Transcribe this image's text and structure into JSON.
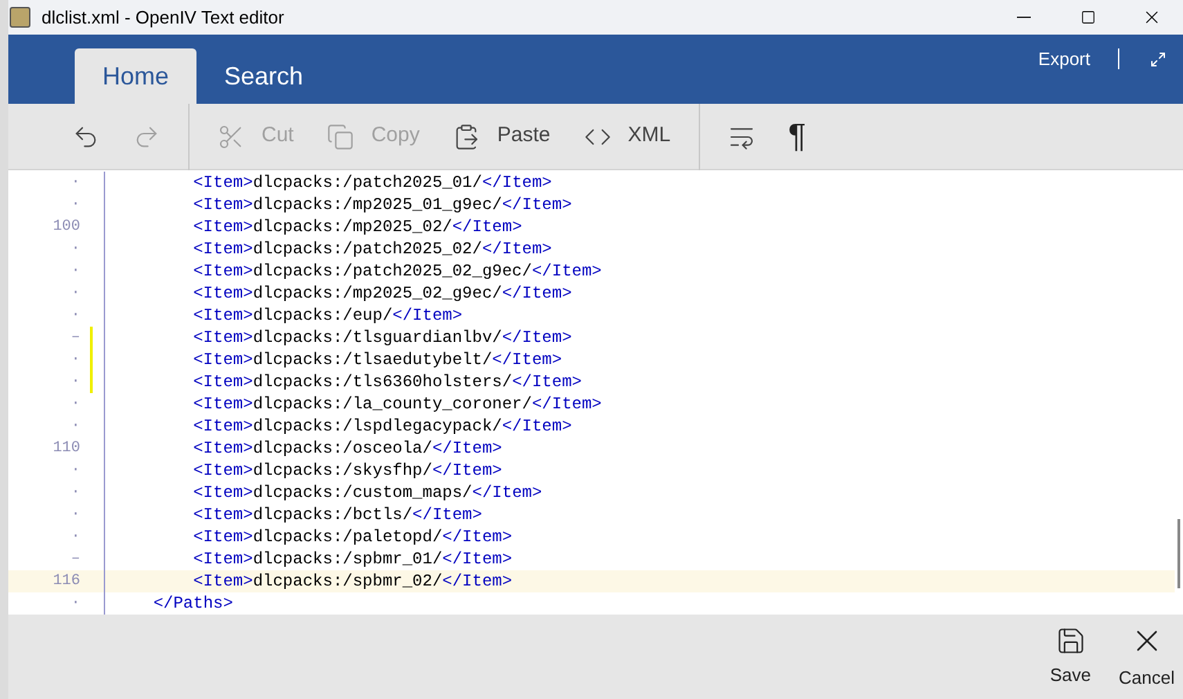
{
  "window": {
    "title": "dlclist.xml - OpenIV Text editor"
  },
  "tabs": [
    {
      "label": "Home",
      "selected": true
    },
    {
      "label": "Search",
      "selected": false
    }
  ],
  "ribbon_actions": {
    "export": "Export"
  },
  "toolbar": [
    {
      "kind": "undo",
      "disabled": false
    },
    {
      "kind": "redo",
      "disabled": true
    },
    {
      "kind": "sep"
    },
    {
      "kind": "cut",
      "label": "Cut",
      "disabled": true
    },
    {
      "kind": "copy",
      "label": "Copy",
      "disabled": true
    },
    {
      "kind": "paste",
      "label": "Paste",
      "disabled": false
    },
    {
      "kind": "xml",
      "label": "XML",
      "disabled": false
    },
    {
      "kind": "sep"
    },
    {
      "kind": "wrap",
      "disabled": false
    },
    {
      "kind": "pilcrow",
      "label": "¶",
      "disabled": false
    }
  ],
  "editor": {
    "lines": [
      {
        "number": "·",
        "text": "        <Item>dlcpacks:/patch2025_01/</Item>",
        "changed": false,
        "current": false
      },
      {
        "number": "·",
        "text": "        <Item>dlcpacks:/mp2025_01_g9ec/</Item>",
        "changed": false,
        "current": false
      },
      {
        "number": "100",
        "text": "        <Item>dlcpacks:/mp2025_02/</Item>",
        "changed": false,
        "current": false
      },
      {
        "number": "·",
        "text": "        <Item>dlcpacks:/patch2025_02/</Item>",
        "changed": false,
        "current": false
      },
      {
        "number": "·",
        "text": "        <Item>dlcpacks:/patch2025_02_g9ec/</Item>",
        "changed": false,
        "current": false
      },
      {
        "number": "·",
        "text": "        <Item>dlcpacks:/mp2025_02_g9ec/</Item>",
        "changed": false,
        "current": false
      },
      {
        "number": "·",
        "text": "        <Item>dlcpacks:/eup/</Item>",
        "changed": false,
        "current": false
      },
      {
        "number": "–",
        "text": "        <Item>dlcpacks:/tlsguardianlbv/</Item>",
        "changed": true,
        "current": false
      },
      {
        "number": "·",
        "text": "        <Item>dlcpacks:/tlsaedutybelt/</Item>",
        "changed": true,
        "current": false
      },
      {
        "number": "·",
        "text": "        <Item>dlcpacks:/tls6360holsters/</Item>",
        "changed": true,
        "current": false
      },
      {
        "number": "·",
        "text": "        <Item>dlcpacks:/la_county_coroner/</Item>",
        "changed": false,
        "current": false
      },
      {
        "number": "·",
        "text": "        <Item>dlcpacks:/lspdlegacypack/</Item>",
        "changed": false,
        "current": false
      },
      {
        "number": "110",
        "text": "        <Item>dlcpacks:/osceola/</Item>",
        "changed": false,
        "current": false
      },
      {
        "number": "·",
        "text": "        <Item>dlcpacks:/skysfhp/</Item>",
        "changed": false,
        "current": false
      },
      {
        "number": "·",
        "text": "        <Item>dlcpacks:/custom_maps/</Item>",
        "changed": false,
        "current": false
      },
      {
        "number": "·",
        "text": "        <Item>dlcpacks:/bctls/</Item>",
        "changed": false,
        "current": false
      },
      {
        "number": "·",
        "text": "        <Item>dlcpacks:/paletopd/</Item>",
        "changed": false,
        "current": false
      },
      {
        "number": "–",
        "text": "        <Item>dlcpacks:/spbmr_01/</Item>",
        "changed": false,
        "current": false
      },
      {
        "number": "116",
        "text": "        <Item>dlcpacks:/spbmr_02/</Item>",
        "changed": false,
        "current": true
      },
      {
        "number": "·",
        "text": "    </Paths>",
        "changed": false,
        "current": false
      }
    ]
  },
  "footer": [
    {
      "kind": "save",
      "label": "Save"
    },
    {
      "kind": "cancel",
      "label": "Cancel"
    }
  ]
}
